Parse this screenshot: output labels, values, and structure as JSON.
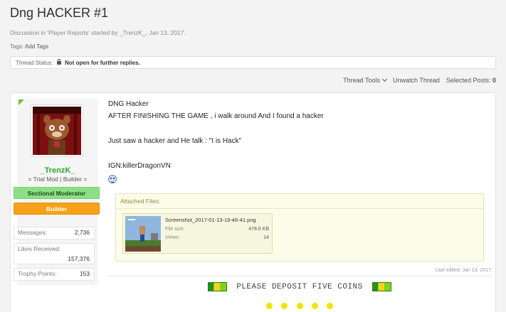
{
  "thread": {
    "title": "Dng HACKER #1",
    "meta_prefix": "Discussion in '",
    "forum": "Player Reports",
    "meta_mid": "' started by ",
    "author": "_TrenzK_",
    "meta_sep": ", ",
    "date": "Jan 13, 2017.",
    "tags_label": "Tags:",
    "add_tags": "Add Tags",
    "status_label": "Thread Status:",
    "status_value": "Not open for further replies."
  },
  "toolbar": {
    "thread_tools": "Thread Tools",
    "unwatch": "Unwatch Thread",
    "selected_posts_label": "Selected Posts:",
    "selected_posts_count": "0"
  },
  "user": {
    "name": "_TrenzK_",
    "title": "= Trial Mod | Builder =",
    "badge_mod": "Sectional Moderator",
    "badge_builder": "Builder",
    "stats": [
      {
        "label": "Messages:",
        "value": "2,736"
      },
      {
        "label": "Likes Received:",
        "value": "157,376"
      },
      {
        "label": "Trophy Points:",
        "value": "153"
      }
    ]
  },
  "post": {
    "lines": [
      "DNG Hacker",
      "AFTER FINISHING THE GAME , i walk around And I found a hacker",
      "Just saw a hacker and He talk : \"I is Hack\"",
      "IGN:killerDragonVN"
    ],
    "attached_label": "Attached Files:",
    "file": {
      "name": "Screenshot_2017-01-13-19-46-41.png",
      "size_label": "File size:",
      "size_value": "478.6 KB",
      "views_label": "Views:",
      "views_value": "14"
    },
    "last_edited": "Last edited: Jan 13, 2017",
    "signature": "PLEASE DEPOSIT FIVE COINS"
  },
  "colors": {
    "username": "#2aa82a",
    "mod_badge": "#8ddf86",
    "builder_badge": "#f7a019",
    "coin": "#f0e400"
  }
}
